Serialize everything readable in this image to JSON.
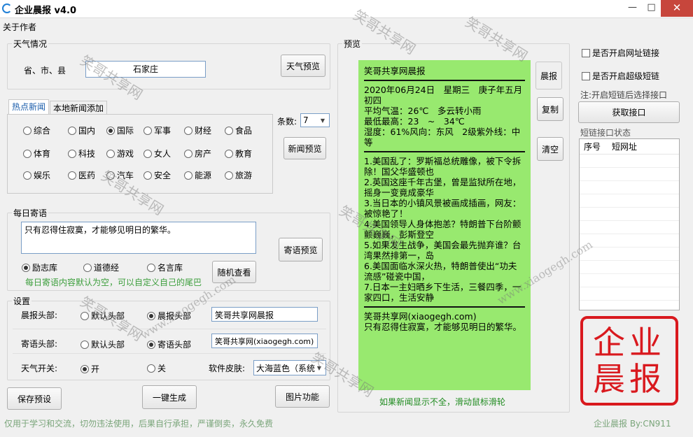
{
  "window": {
    "title": "企业晨报 v4.0",
    "minimize": "—",
    "maximize": "□",
    "close": "✕"
  },
  "menu": {
    "about": "关于作者"
  },
  "weather": {
    "legend": "天气情况",
    "region_label": "省、市、县",
    "region_value": "石家庄",
    "preview_btn": "天气预览"
  },
  "news": {
    "tabs": [
      "热点新闻",
      "本地新闻添加"
    ],
    "categories_row1": [
      "综合",
      "国内",
      "国际",
      "军事",
      "财经",
      "食品"
    ],
    "categories_row2": [
      "体育",
      "科技",
      "游戏",
      "女人",
      "房产",
      "教育"
    ],
    "categories_row3": [
      "娱乐",
      "医药",
      "汽车",
      "安全",
      "能源",
      "旅游"
    ],
    "selected": "国际",
    "count_label": "条数:",
    "count_value": "7",
    "preview_btn": "新闻预览"
  },
  "quote": {
    "legend": "每日寄语",
    "text": "只有忍得住寂寞，才能够见明日的繁华。",
    "preview_btn": "寄语预览",
    "sources": [
      "励志库",
      "道德经",
      "名言库"
    ],
    "selected": "励志库",
    "random_btn": "随机查看",
    "hint": "每日寄语内容默认为空，可以自定义自己的尾巴"
  },
  "settings": {
    "legend": "设置",
    "morning_header_label": "晨报头部:",
    "morning_opts": [
      "默认头部",
      "晨报头部"
    ],
    "morning_selected": "晨报头部",
    "morning_value": "笑哥共享网晨报",
    "quote_header_label": "寄语头部:",
    "quote_opts": [
      "默认头部",
      "寄语头部"
    ],
    "quote_selected": "寄语头部",
    "quote_value": "笑哥共享网(xiaogegh.com)",
    "weather_switch_label": "天气开关:",
    "weather_opts": [
      "开",
      "关"
    ],
    "weather_selected": "开",
    "skin_label": "软件皮肤:",
    "skin_value": "大海蓝色（系统"
  },
  "actions": {
    "save": "保存预设",
    "generate": "一键生成",
    "image": "图片功能"
  },
  "preview": {
    "legend": "预览",
    "header": "笑哥共享网晨报",
    "date": "2020年06月24日　星期三　庚子年五月初四",
    "temp": "平均气温：26℃　多云转小雨",
    "range": "最低最高：23　~　34℃",
    "humidity": "湿度：61%风向：东风　2级紫外线：中等",
    "items": [
      "1.美国乱了：罗斯福总统雕像，被下令拆除！国父华盛顿也",
      "2.英国这座千年古堡，曾是监狱所在地，摇身一变竟成豪华",
      "3.当日本的小镇风景被画成插画，网友：被惊艳了！",
      "4.美国领导人身体抱恙？特朗普下台阶颤颤巍巍，彭斯登空",
      "5.如果发生战争，美国会最先抛弃谁？台湾果然排第一，岛",
      "6.美国面临水深火热，特朗普使出“功夫流感”碰瓷中国，",
      "7.日本一主妇晒乡下生活，三餐四季，一家四口，生活安静"
    ],
    "footer_site": "笑哥共享网(xiaogegh.com)",
    "footer_quote": "只有忍得住寂寞，才能够见明日的繁华。",
    "scroll_hint": "如果新闻显示不全，滑动鼠标滑轮"
  },
  "side": {
    "morning_btn": "晨报",
    "copy_btn": "复制",
    "clear_btn": "清空"
  },
  "shortlink": {
    "enable_url": "是否开启网址链接",
    "enable_short": "是否开启超级短链",
    "note": "注:开启短链后选择接口",
    "get_btn": "获取接口",
    "status_label": "短链接口状态",
    "col_no": "序号",
    "col_url": "短网址"
  },
  "seal": {
    "row1": "企业",
    "row2": "晨报"
  },
  "status": {
    "left": "仅用于学习和交流，切勿违法使用，后果自行承担，严谨倒卖，永久免费",
    "right": "企业晨报 By:CN911"
  },
  "watermark": {
    "text1": "笑哥共享网",
    "text2": "www.xiaogegh.com"
  }
}
